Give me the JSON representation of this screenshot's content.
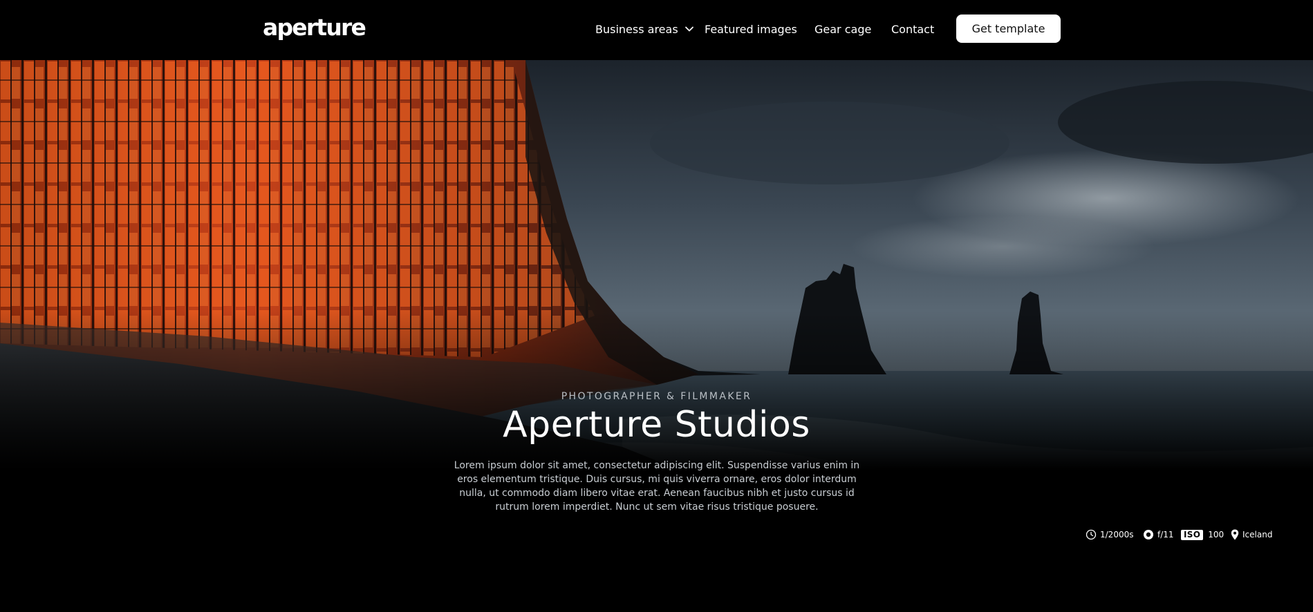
{
  "nav": {
    "logo": "aperture",
    "items": [
      {
        "label": "Business areas",
        "icon": "chevron-down-icon"
      },
      {
        "label": "Featured images"
      },
      {
        "label": "Gear cage"
      },
      {
        "label": "Contact"
      }
    ],
    "cta": "Get template"
  },
  "hero": {
    "eyebrow": "PHOTOGRAPHER & FILMMAKER",
    "title": "Aperture Studios",
    "description": "Lorem ipsum dolor sit amet, consectetur adipiscing elit. Suspendisse varius enim in eros elementum tristique. Duis cursus, mi quis viverra ornare, eros dolor interdum nulla, ut commodo diam libero vitae erat. Aenean faucibus nibh et justo cursus id rutrum lorem imperdiet. Nunc ut sem vitae risus tristique posuere."
  },
  "exif": {
    "shutter": {
      "icon": "clock-icon",
      "value": "1/2000s"
    },
    "aperture": {
      "icon": "aperture-icon",
      "value": "f/11"
    },
    "iso": {
      "label": "ISO",
      "value": "100"
    },
    "location": {
      "icon": "location-pin-icon",
      "value": "Iceland"
    }
  },
  "colors": {
    "background": "#000000",
    "cta_background": "#ffffff",
    "cta_text": "#111111",
    "lava_orange": "#e8501a",
    "sky": "#3a4652"
  }
}
